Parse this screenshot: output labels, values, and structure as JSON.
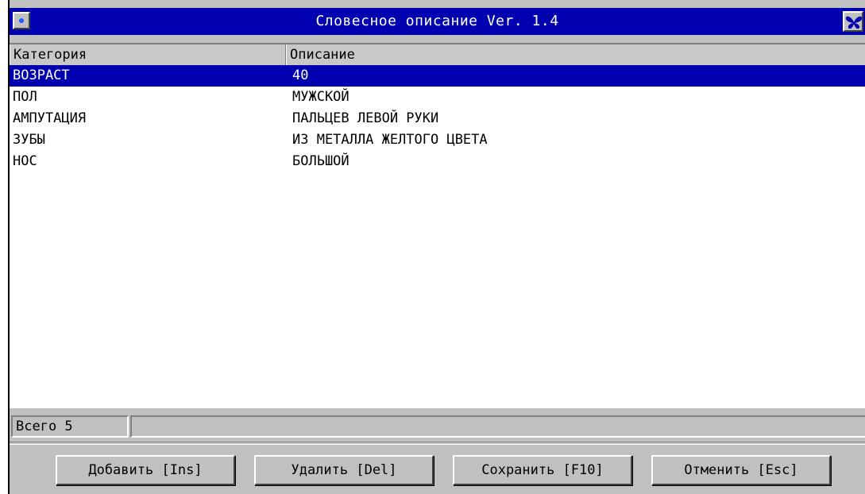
{
  "window": {
    "title": "Словесное описание Ver. 1.4"
  },
  "list": {
    "columns": [
      "Категория",
      "Описание"
    ],
    "rows": [
      {
        "category": "ВОЗРАСТ",
        "description": "40",
        "selected": true
      },
      {
        "category": "ПОЛ",
        "description": "МУЖСКОЙ",
        "selected": false
      },
      {
        "category": "АМПУТАЦИЯ",
        "description": "ПАЛЬЦЕВ ЛЕВОЙ РУКИ",
        "selected": false
      },
      {
        "category": "ЗУБЫ",
        "description": "ИЗ МЕТАЛЛА ЖЕЛТОГО ЦВЕТА",
        "selected": false
      },
      {
        "category": "НОС",
        "description": "БОЛЬШОЙ",
        "selected": false
      }
    ]
  },
  "status": {
    "count_label": "Всего 5"
  },
  "buttons": {
    "add": "Добавить [Ins]",
    "delete": "Удалить [Del]",
    "save": "Сохранить [F10]",
    "cancel": "Отменить [Esc]"
  },
  "icons": {
    "system_menu": "system-menu-icon",
    "app": "butterfly-icon"
  },
  "colors": {
    "titlebar": "#0000b0",
    "selection": "#0000b0",
    "face": "#c0c0c0"
  }
}
